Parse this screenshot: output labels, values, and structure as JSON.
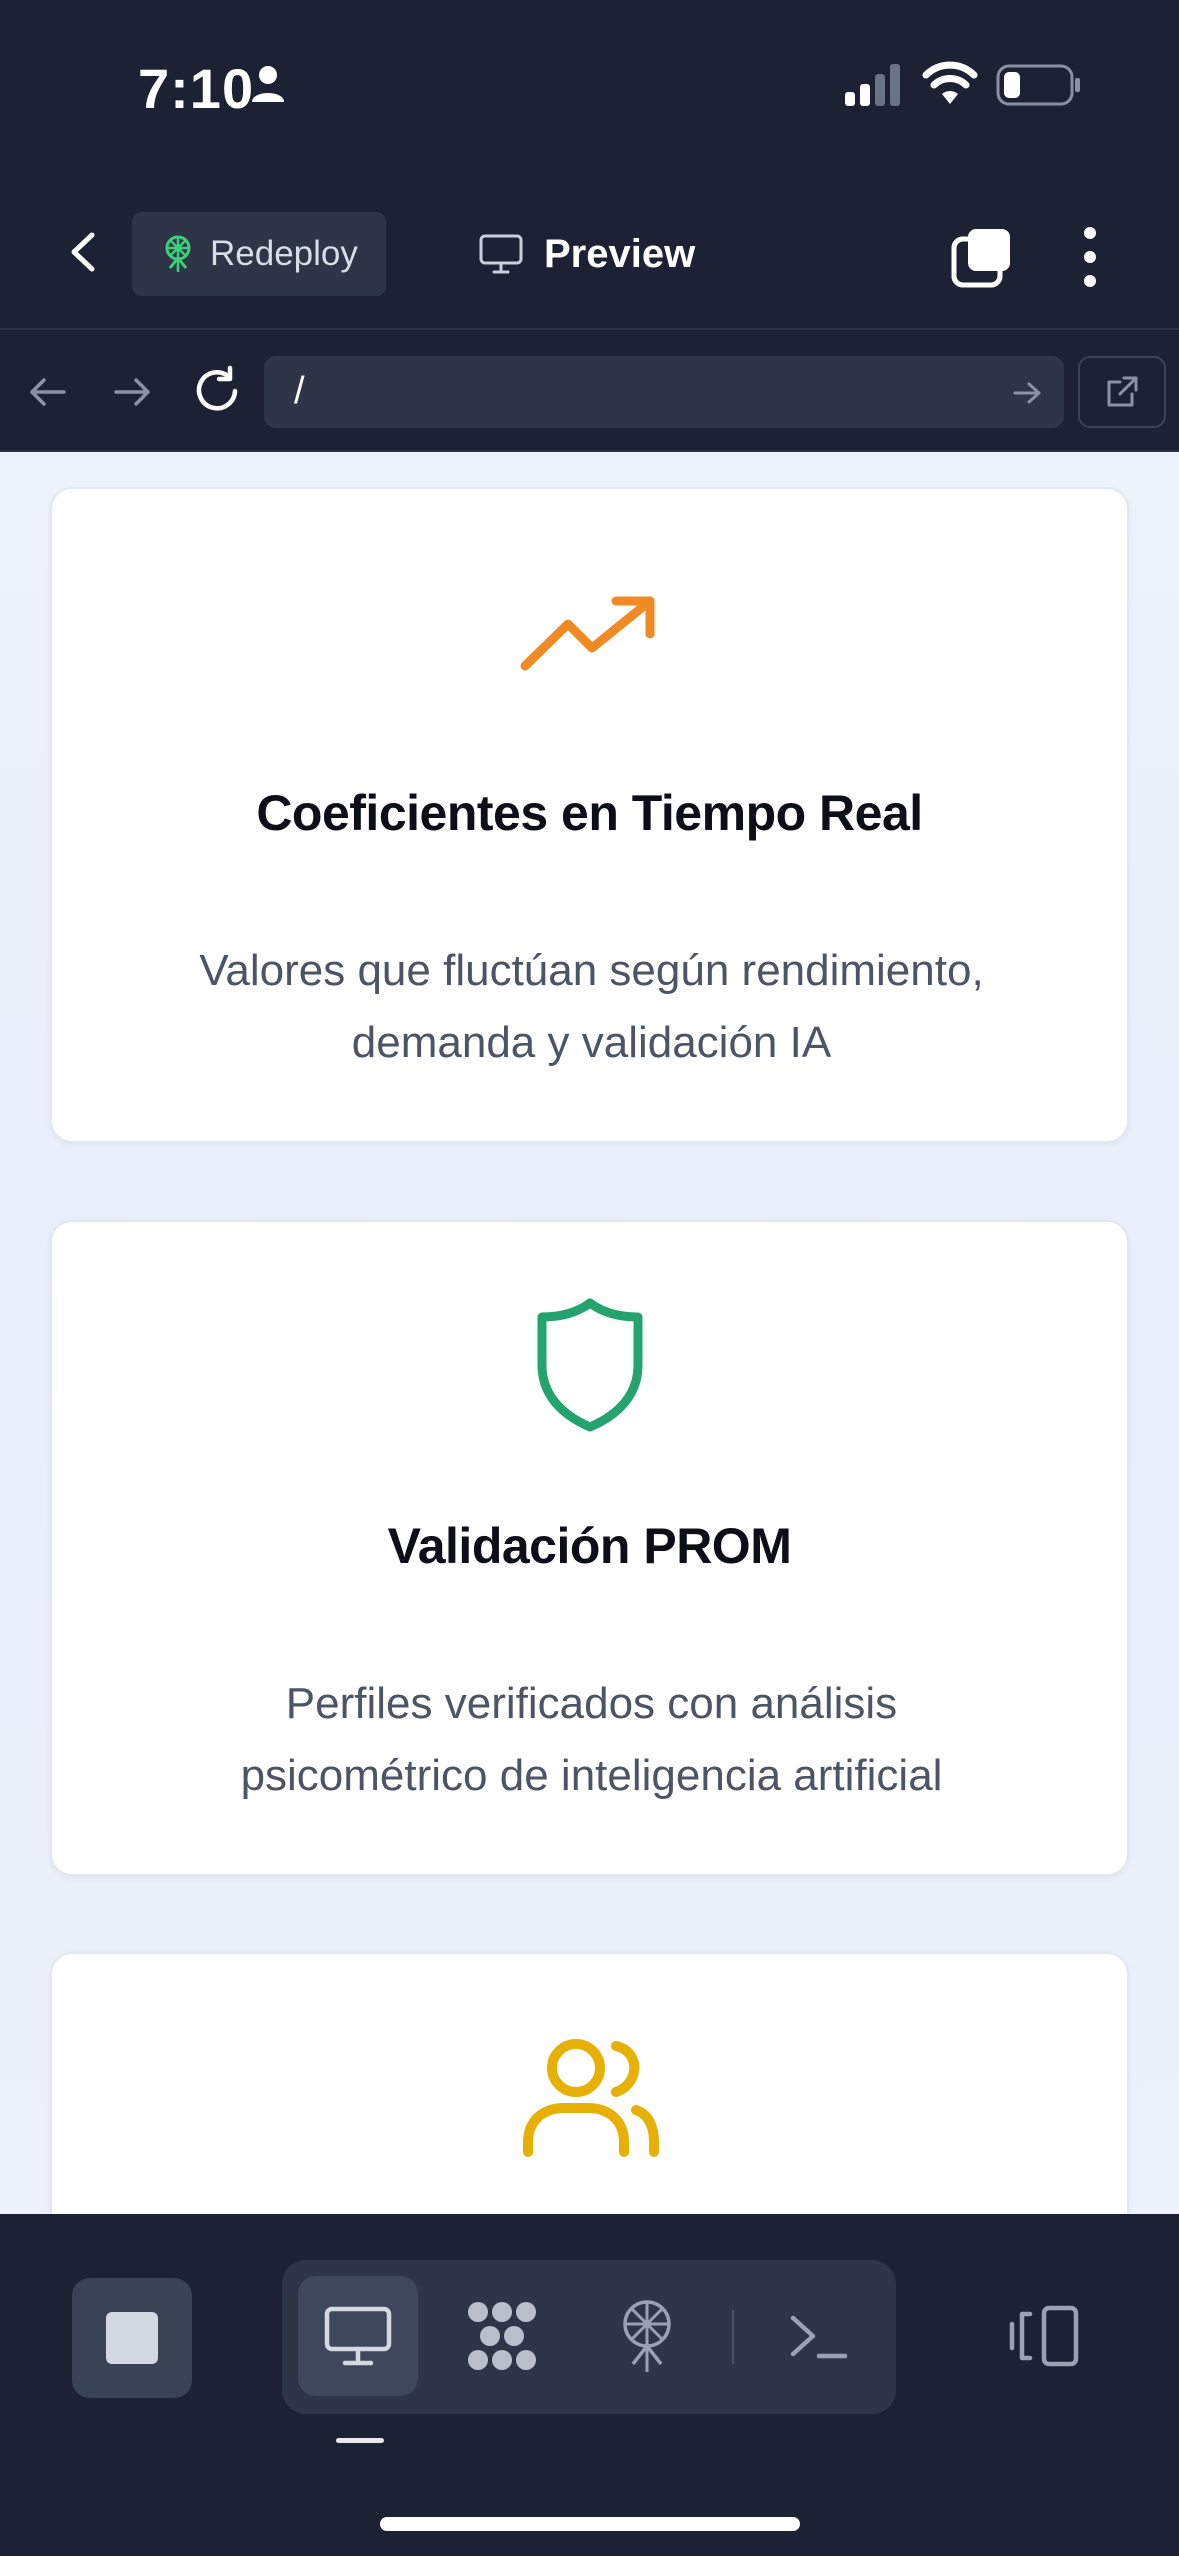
{
  "status_bar": {
    "time": "7:10",
    "icons": [
      "person-icon",
      "cellular-signal-icon",
      "wifi-icon",
      "battery-icon"
    ]
  },
  "app_bar": {
    "redeploy_label": "Redeploy",
    "preview_label": "Preview",
    "icons": [
      "back-chevron-icon",
      "redeploy-antenna-icon",
      "monitor-icon",
      "tabs-icon",
      "more-vertical-icon"
    ]
  },
  "browser_nav": {
    "url": "/",
    "icons": [
      "arrow-left-icon",
      "arrow-right-icon",
      "reload-icon",
      "url-go-arrow-icon",
      "external-link-icon"
    ]
  },
  "cards": [
    {
      "icon": "trending-up-icon",
      "icon_color": "#f08a24",
      "title": "Coeficientes en Tiempo Real",
      "desc_line1": "Valores que fluctúan según rendimiento,",
      "desc_line2": "demanda y validación IA"
    },
    {
      "icon": "shield-icon",
      "icon_color": "#25a36f",
      "title": "Validación PROM",
      "desc_line1": "Perfiles verificados con análisis",
      "desc_line2": "psicométrico de inteligencia artificial"
    },
    {
      "icon": "users-icon",
      "icon_color": "#e6b007",
      "title": "",
      "desc_line1": "",
      "desc_line2": ""
    }
  ],
  "bottom_toolbar": {
    "tools": [
      "stop-icon",
      "monitor-icon",
      "grid-dots-icon",
      "antenna-icon",
      "terminal-icon",
      "side-panel-icon"
    ],
    "active_tool": "monitor-icon"
  },
  "colors": {
    "chrome_bg": "#1c2233",
    "chrome_control_bg": "#2d3547",
    "content_bg": "#eef2fb",
    "card_bg": "#ffffff",
    "redeploy_icon": "#3ecf7a"
  }
}
